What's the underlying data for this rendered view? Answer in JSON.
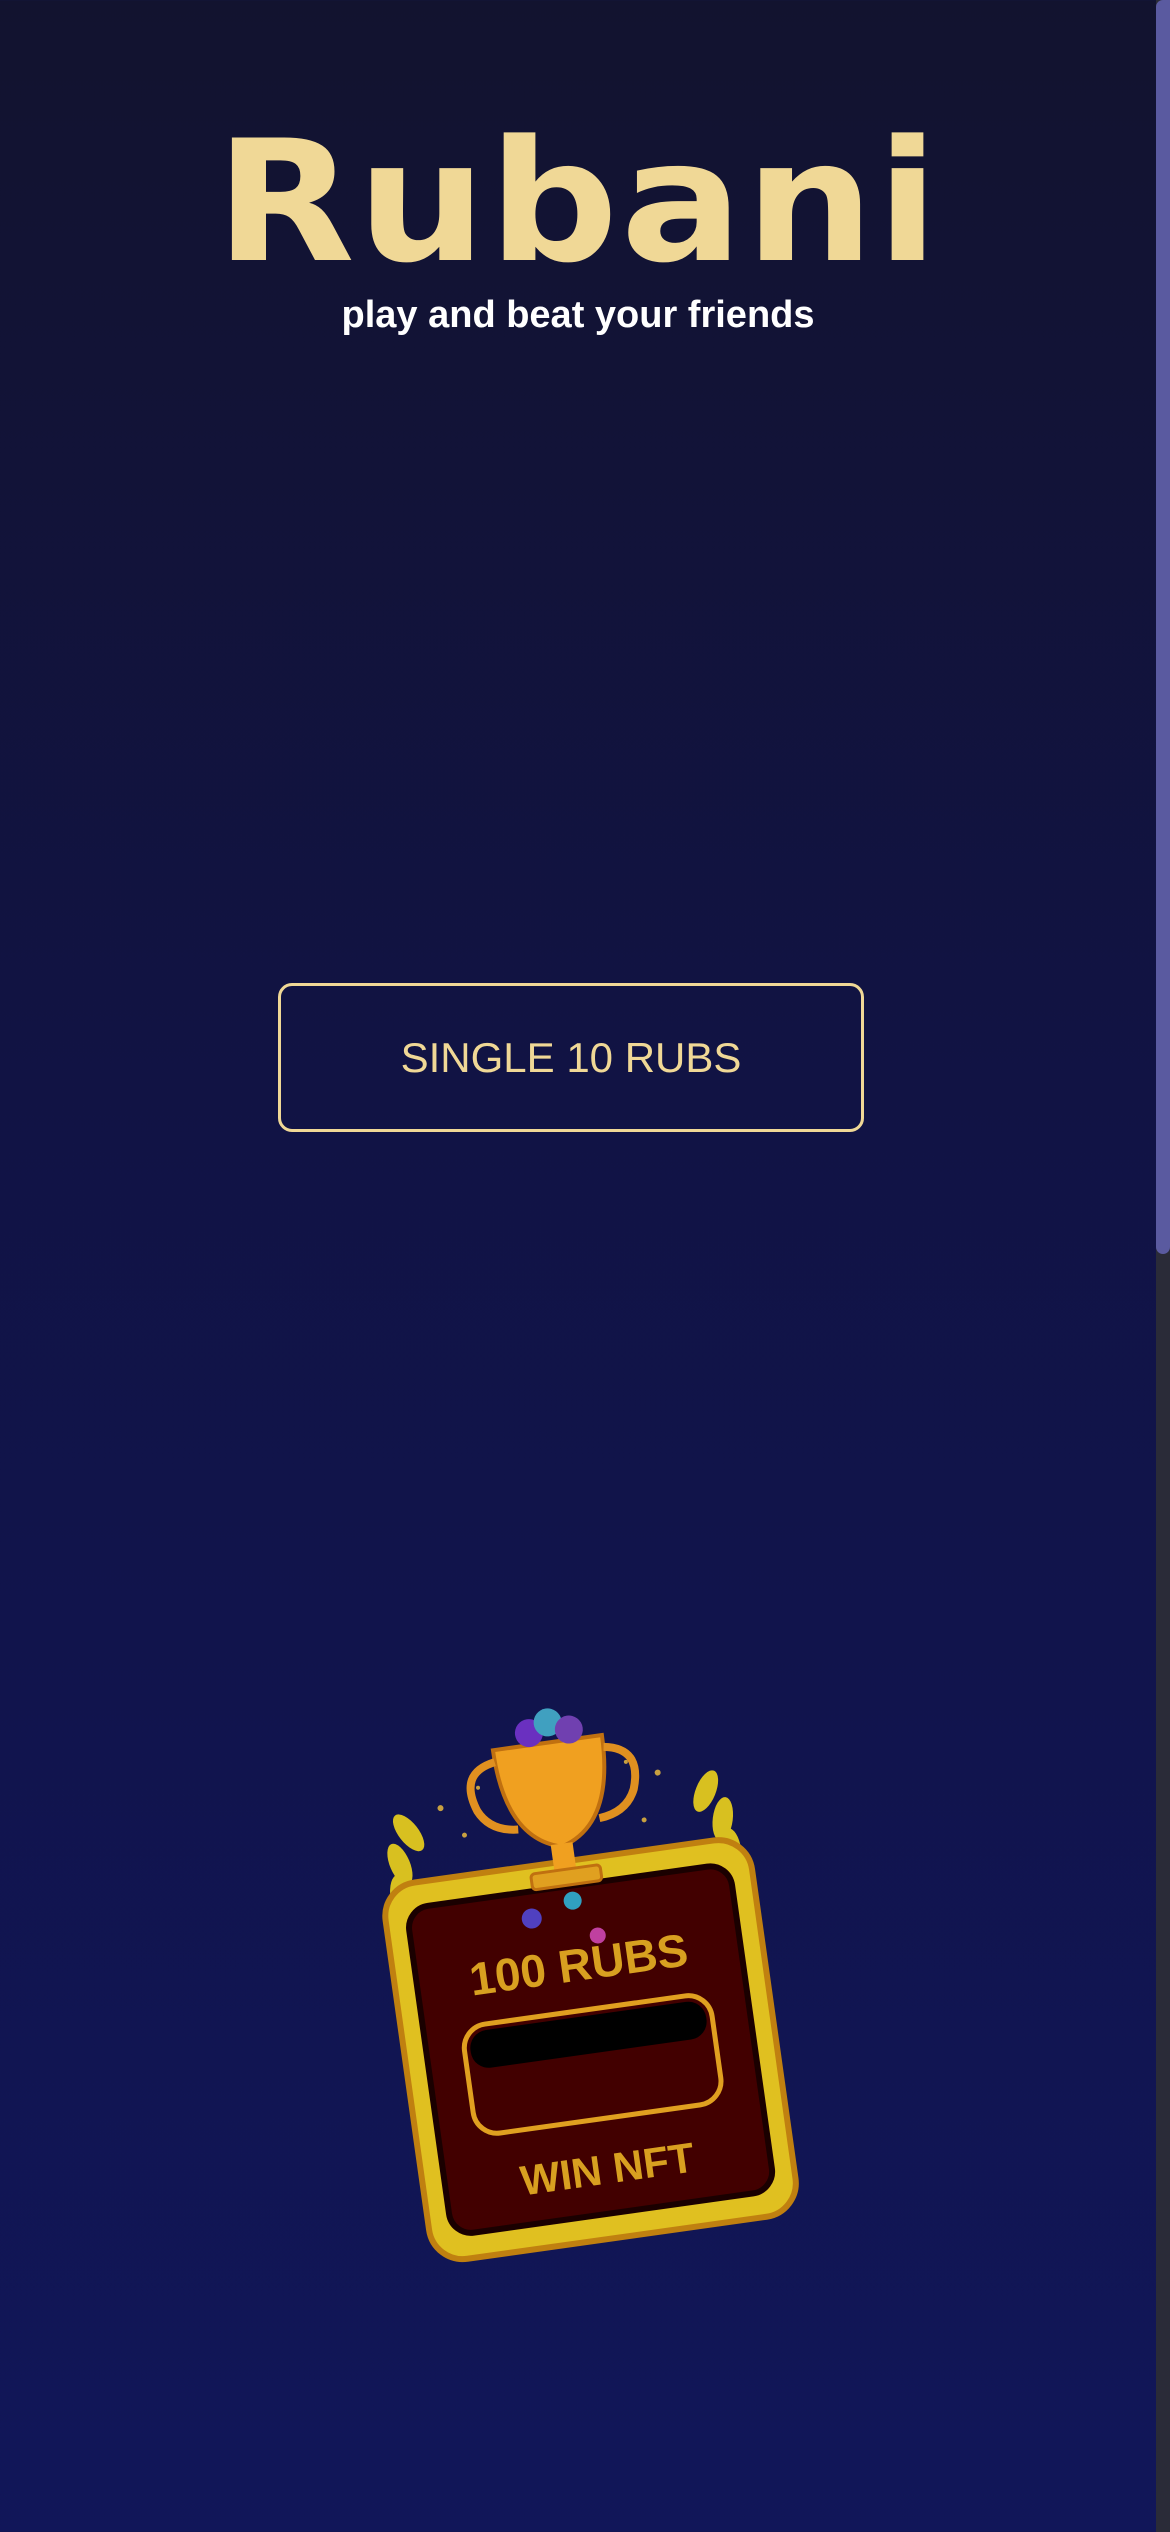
{
  "app": {
    "logo_text": "Rubani",
    "tagline": "play and beat your friends"
  },
  "actions": {
    "single_button_label": "SINGLE 10 RUBS"
  },
  "promo_badge": {
    "top_text": "100 RUBS",
    "bottom_text": "WIN NFT",
    "icon": "trophy-icon"
  },
  "colors": {
    "accent_gold": "#f0d896",
    "background_top": "#12132f",
    "background_bottom": "#111659",
    "badge_frame": "#e0c020",
    "badge_fill": "#420000"
  }
}
